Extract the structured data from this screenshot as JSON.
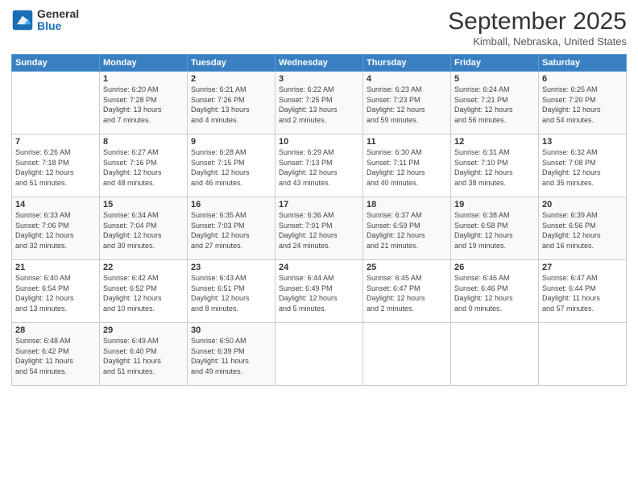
{
  "logo": {
    "general": "General",
    "blue": "Blue"
  },
  "header": {
    "month": "September 2025",
    "location": "Kimball, Nebraska, United States"
  },
  "weekdays": [
    "Sunday",
    "Monday",
    "Tuesday",
    "Wednesday",
    "Thursday",
    "Friday",
    "Saturday"
  ],
  "weeks": [
    [
      {
        "day": "",
        "info": ""
      },
      {
        "day": "1",
        "info": "Sunrise: 6:20 AM\nSunset: 7:28 PM\nDaylight: 13 hours\nand 7 minutes."
      },
      {
        "day": "2",
        "info": "Sunrise: 6:21 AM\nSunset: 7:26 PM\nDaylight: 13 hours\nand 4 minutes."
      },
      {
        "day": "3",
        "info": "Sunrise: 6:22 AM\nSunset: 7:25 PM\nDaylight: 13 hours\nand 2 minutes."
      },
      {
        "day": "4",
        "info": "Sunrise: 6:23 AM\nSunset: 7:23 PM\nDaylight: 12 hours\nand 59 minutes."
      },
      {
        "day": "5",
        "info": "Sunrise: 6:24 AM\nSunset: 7:21 PM\nDaylight: 12 hours\nand 56 minutes."
      },
      {
        "day": "6",
        "info": "Sunrise: 6:25 AM\nSunset: 7:20 PM\nDaylight: 12 hours\nand 54 minutes."
      }
    ],
    [
      {
        "day": "7",
        "info": "Sunrise: 6:26 AM\nSunset: 7:18 PM\nDaylight: 12 hours\nand 51 minutes."
      },
      {
        "day": "8",
        "info": "Sunrise: 6:27 AM\nSunset: 7:16 PM\nDaylight: 12 hours\nand 48 minutes."
      },
      {
        "day": "9",
        "info": "Sunrise: 6:28 AM\nSunset: 7:15 PM\nDaylight: 12 hours\nand 46 minutes."
      },
      {
        "day": "10",
        "info": "Sunrise: 6:29 AM\nSunset: 7:13 PM\nDaylight: 12 hours\nand 43 minutes."
      },
      {
        "day": "11",
        "info": "Sunrise: 6:30 AM\nSunset: 7:11 PM\nDaylight: 12 hours\nand 40 minutes."
      },
      {
        "day": "12",
        "info": "Sunrise: 6:31 AM\nSunset: 7:10 PM\nDaylight: 12 hours\nand 38 minutes."
      },
      {
        "day": "13",
        "info": "Sunrise: 6:32 AM\nSunset: 7:08 PM\nDaylight: 12 hours\nand 35 minutes."
      }
    ],
    [
      {
        "day": "14",
        "info": "Sunrise: 6:33 AM\nSunset: 7:06 PM\nDaylight: 12 hours\nand 32 minutes."
      },
      {
        "day": "15",
        "info": "Sunrise: 6:34 AM\nSunset: 7:04 PM\nDaylight: 12 hours\nand 30 minutes."
      },
      {
        "day": "16",
        "info": "Sunrise: 6:35 AM\nSunset: 7:03 PM\nDaylight: 12 hours\nand 27 minutes."
      },
      {
        "day": "17",
        "info": "Sunrise: 6:36 AM\nSunset: 7:01 PM\nDaylight: 12 hours\nand 24 minutes."
      },
      {
        "day": "18",
        "info": "Sunrise: 6:37 AM\nSunset: 6:59 PM\nDaylight: 12 hours\nand 21 minutes."
      },
      {
        "day": "19",
        "info": "Sunrise: 6:38 AM\nSunset: 6:58 PM\nDaylight: 12 hours\nand 19 minutes."
      },
      {
        "day": "20",
        "info": "Sunrise: 6:39 AM\nSunset: 6:56 PM\nDaylight: 12 hours\nand 16 minutes."
      }
    ],
    [
      {
        "day": "21",
        "info": "Sunrise: 6:40 AM\nSunset: 6:54 PM\nDaylight: 12 hours\nand 13 minutes."
      },
      {
        "day": "22",
        "info": "Sunrise: 6:42 AM\nSunset: 6:52 PM\nDaylight: 12 hours\nand 10 minutes."
      },
      {
        "day": "23",
        "info": "Sunrise: 6:43 AM\nSunset: 6:51 PM\nDaylight: 12 hours\nand 8 minutes."
      },
      {
        "day": "24",
        "info": "Sunrise: 6:44 AM\nSunset: 6:49 PM\nDaylight: 12 hours\nand 5 minutes."
      },
      {
        "day": "25",
        "info": "Sunrise: 6:45 AM\nSunset: 6:47 PM\nDaylight: 12 hours\nand 2 minutes."
      },
      {
        "day": "26",
        "info": "Sunrise: 6:46 AM\nSunset: 6:46 PM\nDaylight: 12 hours\nand 0 minutes."
      },
      {
        "day": "27",
        "info": "Sunrise: 6:47 AM\nSunset: 6:44 PM\nDaylight: 11 hours\nand 57 minutes."
      }
    ],
    [
      {
        "day": "28",
        "info": "Sunrise: 6:48 AM\nSunset: 6:42 PM\nDaylight: 11 hours\nand 54 minutes."
      },
      {
        "day": "29",
        "info": "Sunrise: 6:49 AM\nSunset: 6:40 PM\nDaylight: 11 hours\nand 51 minutes."
      },
      {
        "day": "30",
        "info": "Sunrise: 6:50 AM\nSunset: 6:39 PM\nDaylight: 11 hours\nand 49 minutes."
      },
      {
        "day": "",
        "info": ""
      },
      {
        "day": "",
        "info": ""
      },
      {
        "day": "",
        "info": ""
      },
      {
        "day": "",
        "info": ""
      }
    ]
  ]
}
